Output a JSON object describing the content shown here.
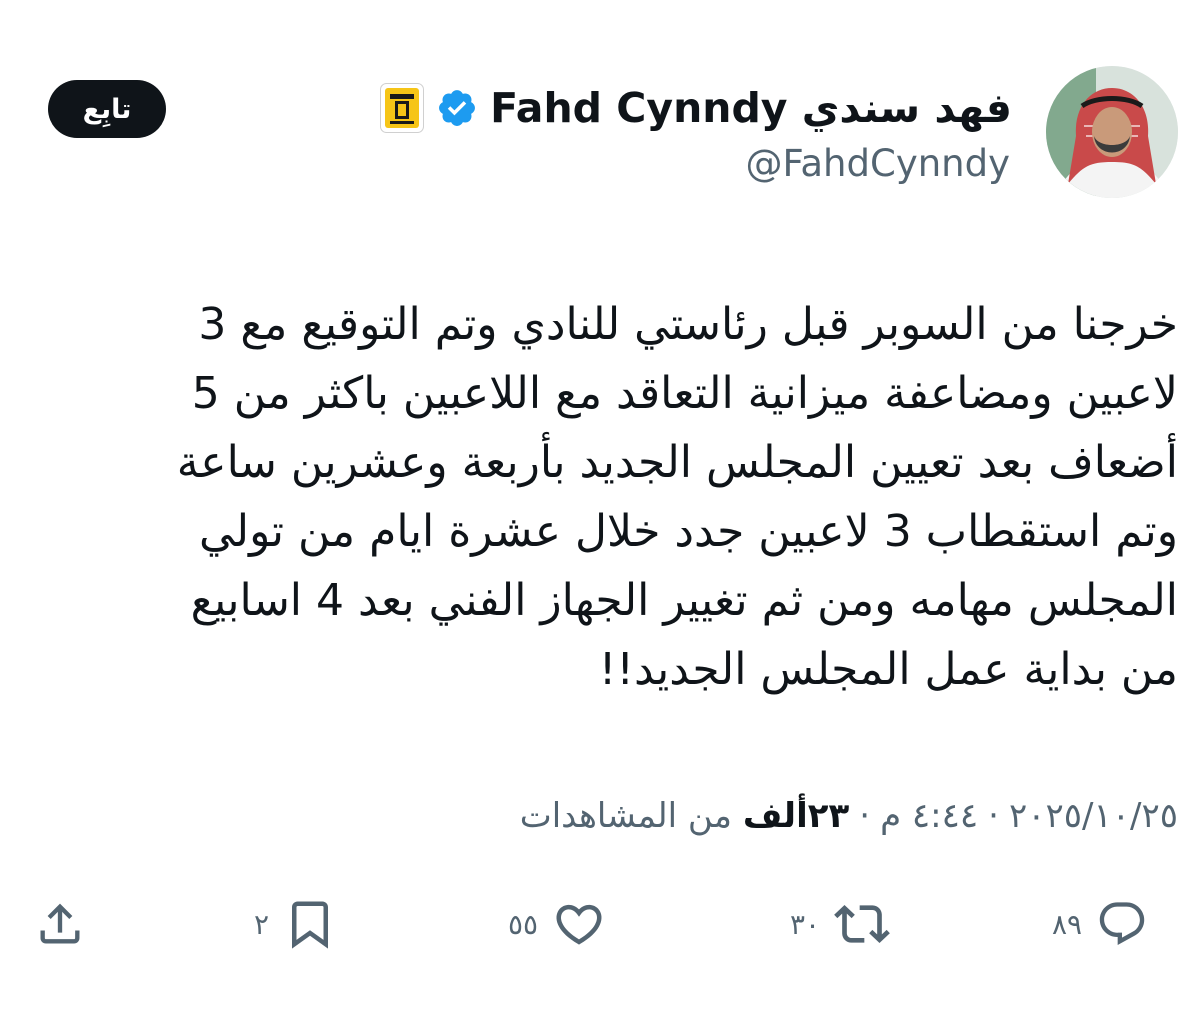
{
  "author": {
    "display_name": "فهد سندي Fahd Cynndy",
    "handle": "@FahdCynndy",
    "avatar_icon": "profile-photo",
    "verified_icon": "verified-badge-icon",
    "affiliate_icon": "club-logo-icon"
  },
  "follow_button": {
    "label": "تابِع"
  },
  "tweet": {
    "text": "خرجنا من السوبر قبل رئاستي للنادي وتم التوقيع مع 3\nلاعبين ومضاعفة ميزانية التعاقد مع اللاعبين باكثر من 5\nأضعاف بعد تعيين المجلس الجديد بأربعة وعشرين ساعة\nوتم استقطاب 3 لاعبين جدد خلال عشرة ايام من تولي\nالمجلس مهامه ومن ثم تغيير الجهاز الفني بعد 4 اسابيع\nمن بداية عمل المجلس الجديد!!"
  },
  "meta": {
    "date": "٢٠٢٥/١٠/٢٥",
    "separator": "·",
    "time": "٤:٤٤ م",
    "views_count": "٢٣ألف",
    "views_label": "من المشاهدات"
  },
  "actions": {
    "replies": "٨٩",
    "reposts": "٣٠",
    "likes": "٥٥",
    "bookmarks": "٢"
  },
  "colors": {
    "text_primary": "#0f1419",
    "text_secondary": "#536471",
    "verified_blue": "#1d9bf0",
    "club_gold": "#f6c517"
  }
}
